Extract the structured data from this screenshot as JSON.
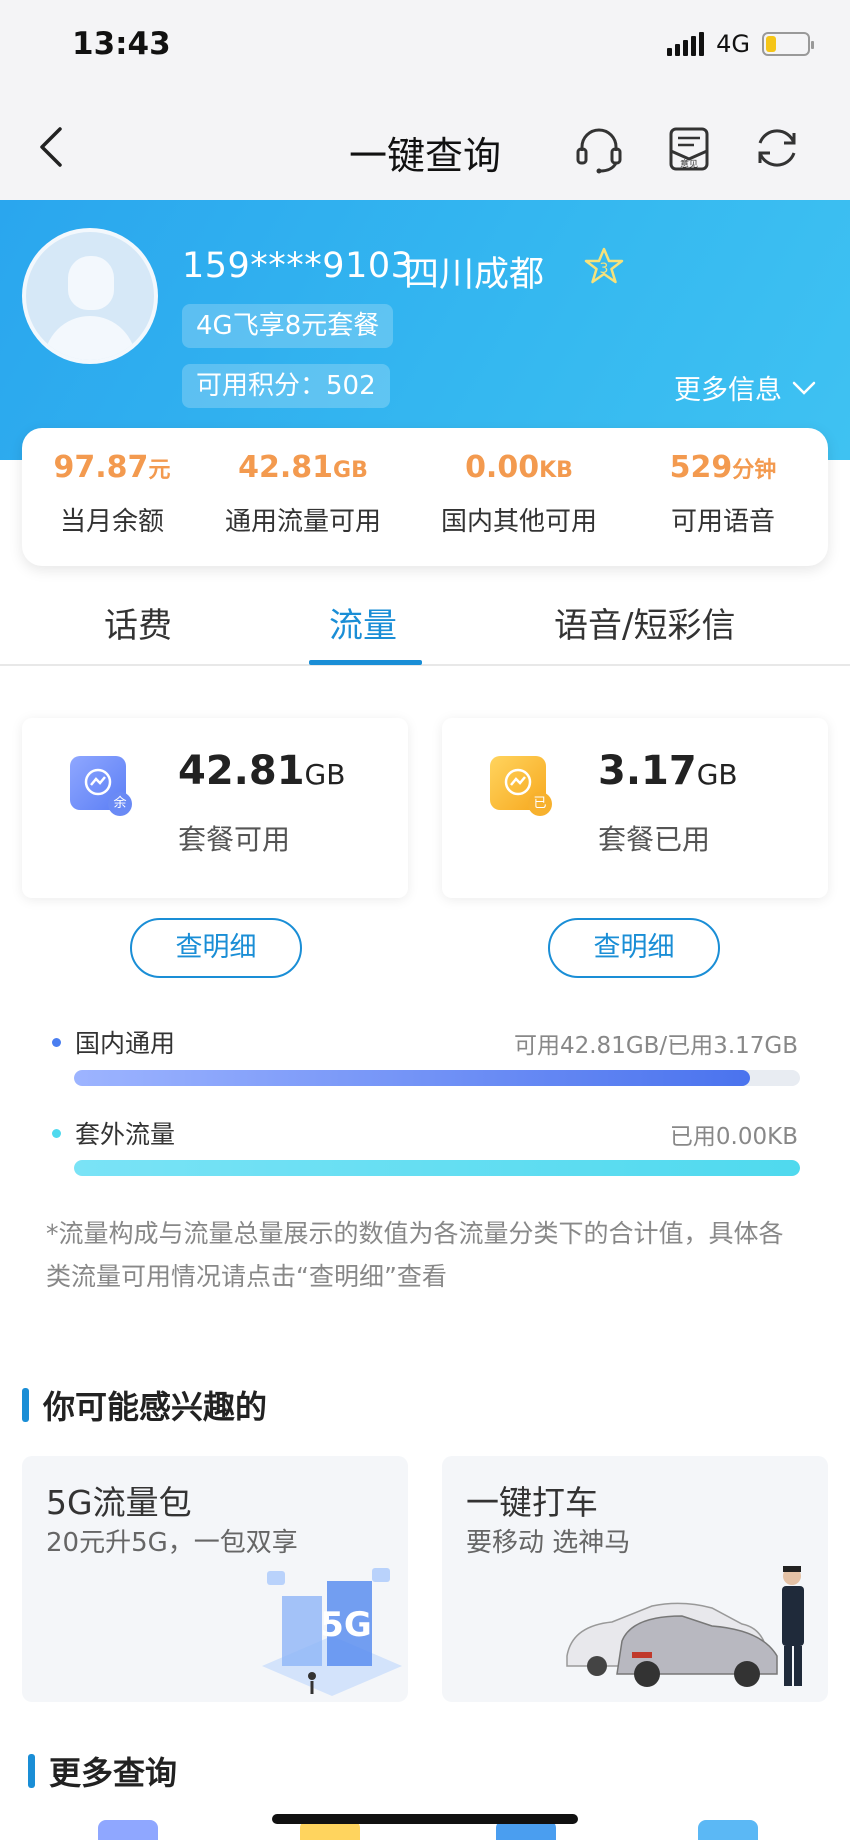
{
  "status_bar": {
    "time": "13:43",
    "network": "4G",
    "battery_level": 0.2
  },
  "nav": {
    "title": "一键查询",
    "icons": [
      "back-icon",
      "headset-icon",
      "feedback-icon",
      "refresh-icon"
    ],
    "feedback_icon_text": "意见"
  },
  "profile": {
    "phone": "159****9103",
    "city": "四川成都",
    "star_level": "3",
    "plan": "4G飞享8元套餐",
    "points": "可用积分：502",
    "more_info": "更多信息"
  },
  "stats": [
    {
      "value": "97.87",
      "unit": "元",
      "label": "当月余额"
    },
    {
      "value": "42.81",
      "unit": "GB",
      "label": "通用流量可用"
    },
    {
      "value": "0.00",
      "unit": "KB",
      "label": "国内其他可用"
    },
    {
      "value": "529",
      "unit": "分钟",
      "label": "可用语音"
    }
  ],
  "tabs": [
    {
      "label": "话费",
      "active": false
    },
    {
      "label": "流量",
      "active": true
    },
    {
      "label": "语音/短彩信",
      "active": false
    }
  ],
  "usage_cards": [
    {
      "value": "42.81",
      "unit": "GB",
      "label": "套餐可用",
      "badge": "余",
      "detail_button": "查明细"
    },
    {
      "value": "3.17",
      "unit": "GB",
      "label": "套餐已用",
      "badge": "已",
      "detail_button": "查明细"
    }
  ],
  "usage_rows": [
    {
      "label": "国内通用",
      "value": "可用42.81GB/已用3.17GB",
      "fill_fraction": 0.931,
      "dot_color": "#4a7ef0"
    },
    {
      "label": "套外流量",
      "value": "已用0.00KB",
      "fill_fraction": 1.0,
      "dot_color": "#4fd9ee"
    }
  ],
  "note": "*流量构成与流量总量展示的数值为各流量分类下的合计值，具体各类流量可用情况请点击“查明细”查看",
  "interests": {
    "title": "你可能感兴趣的",
    "items": [
      {
        "title": "5G流量包",
        "subtitle": "20元升5G，一包双享",
        "badge_text": "5G"
      },
      {
        "title": "一键打车",
        "subtitle": "要移动 选神马"
      }
    ]
  },
  "more_queries": {
    "title": "更多查询"
  },
  "colors": {
    "accent": "#1a8ed6",
    "stat_value": "#f39a4f",
    "header_start": "#2aa6ee",
    "header_end": "#3fc2f2"
  }
}
